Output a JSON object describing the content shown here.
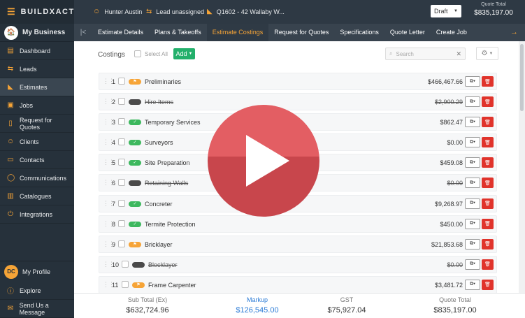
{
  "brand": {
    "name": "BUILDXACT"
  },
  "sidebar": {
    "business": "My Business",
    "items": [
      {
        "label": "Dashboard",
        "icon": "chart-icon"
      },
      {
        "label": "Leads",
        "icon": "arrows-icon"
      },
      {
        "label": "Estimates",
        "icon": "estimate-icon"
      },
      {
        "label": "Jobs",
        "icon": "briefcase-icon"
      },
      {
        "label": "Request for Quotes",
        "icon": "document-icon"
      },
      {
        "label": "Clients",
        "icon": "person-icon"
      },
      {
        "label": "Contacts",
        "icon": "contact-card-icon"
      },
      {
        "label": "Communications",
        "icon": "chat-icon"
      },
      {
        "label": "Catalogues",
        "icon": "book-icon"
      },
      {
        "label": "Integrations",
        "icon": "plug-icon"
      }
    ],
    "profile": {
      "initials": "DC",
      "label": "My Profile"
    },
    "explore": "Explore",
    "message": "Send Us a Message"
  },
  "header": {
    "user": "Hunter Austin",
    "lead": "Lead unassigned",
    "quote_ref": "Q1602 - 42 Wallaby W...",
    "status": "Draft",
    "quote_total_label": "Quote Total",
    "quote_total": "$835,197.00"
  },
  "tabs": [
    "Estimate Details",
    "Plans & Takeoffs",
    "Estimate Costings",
    "Request for Quotes",
    "Specifications",
    "Quote Letter",
    "Create Job"
  ],
  "toolbar": {
    "title": "Costings",
    "select_all": "Select All",
    "add": "Add",
    "search_placeholder": "Search"
  },
  "costings": [
    {
      "n": "1",
      "name": "Preliminaries",
      "amount": "$466,467.66",
      "status": "orange",
      "struck": false
    },
    {
      "n": "2",
      "name": "Hire Items",
      "amount": "$2,900.29",
      "status": "dark",
      "struck": true
    },
    {
      "n": "3",
      "name": "Temporary Services",
      "amount": "$862.47",
      "status": "green",
      "struck": false
    },
    {
      "n": "4",
      "name": "Surveyors",
      "amount": "$0.00",
      "status": "green",
      "struck": false
    },
    {
      "n": "5",
      "name": "Site Preparation",
      "amount": "$459.08",
      "status": "green",
      "struck": false
    },
    {
      "n": "6",
      "name": "Retaining Walls",
      "amount": "$0.00",
      "status": "dark",
      "struck": true
    },
    {
      "n": "7",
      "name": "Concreter",
      "amount": "$9,268.97",
      "status": "green",
      "struck": false
    },
    {
      "n": "8",
      "name": "Termite Protection",
      "amount": "$450.00",
      "status": "green",
      "struck": false
    },
    {
      "n": "9",
      "name": "Bricklayer",
      "amount": "$21,853.68",
      "status": "orange",
      "struck": false
    },
    {
      "n": "10",
      "name": "Blocklayer",
      "amount": "$0.00",
      "status": "dark",
      "struck": true
    },
    {
      "n": "11",
      "name": "Frame Carpenter",
      "amount": "$3,481.72",
      "status": "orange",
      "struck": false
    }
  ],
  "footer": {
    "subtotal_label": "Sub Total (Ex)",
    "subtotal": "$632,724.96",
    "markup_label": "Markup",
    "markup": "$126,545.00",
    "gst_label": "GST",
    "gst": "$75,927.04",
    "quote_total_label": "Quote Total",
    "quote_total": "$835,197.00"
  },
  "colors": {
    "accent": "#f6a437",
    "add_button": "#23b06b",
    "delete_button": "#e0332b",
    "status_green": "#3db85e",
    "status_orange": "#f6a437",
    "status_dark": "#4a4a4a",
    "play_overlay": "#e35e63"
  }
}
